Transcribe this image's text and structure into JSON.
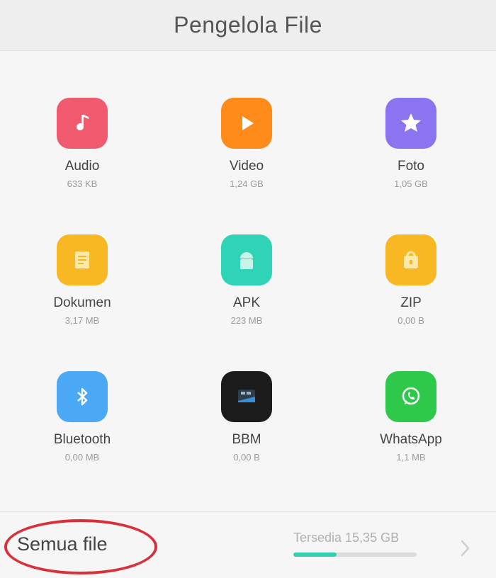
{
  "header": {
    "title": "Pengelola File"
  },
  "categories": [
    {
      "label": "Audio",
      "size": "633 KB",
      "icon": "music-note-icon",
      "color": "#f05a6e"
    },
    {
      "label": "Video",
      "size": "1,24 GB",
      "icon": "play-icon",
      "color": "#ff8c1a"
    },
    {
      "label": "Foto",
      "size": "1,05 GB",
      "icon": "star-icon",
      "color": "#8b74f0"
    },
    {
      "label": "Dokumen",
      "size": "3,17 MB",
      "icon": "document-icon",
      "color": "#f7b824"
    },
    {
      "label": "APK",
      "size": "223 MB",
      "icon": "android-icon",
      "color": "#2fd3b5"
    },
    {
      "label": "ZIP",
      "size": "0,00 B",
      "icon": "zip-icon",
      "color": "#f7b824"
    },
    {
      "label": "Bluetooth",
      "size": "0,00 MB",
      "icon": "bluetooth-icon",
      "color": "#4aa8f5"
    },
    {
      "label": "BBM",
      "size": "0,00 B",
      "icon": "bbm-icon",
      "color": "#1b1b1b"
    },
    {
      "label": "WhatsApp",
      "size": "1,1 MB",
      "icon": "whatsapp-icon",
      "color": "#2ec84a"
    }
  ],
  "footer": {
    "all_files_label": "Semua file",
    "storage_text": "Tersedia 15,35 GB",
    "storage_used_fraction": 0.35,
    "accent_color": "#35cfb0",
    "annotation_color": "#d9303a"
  }
}
